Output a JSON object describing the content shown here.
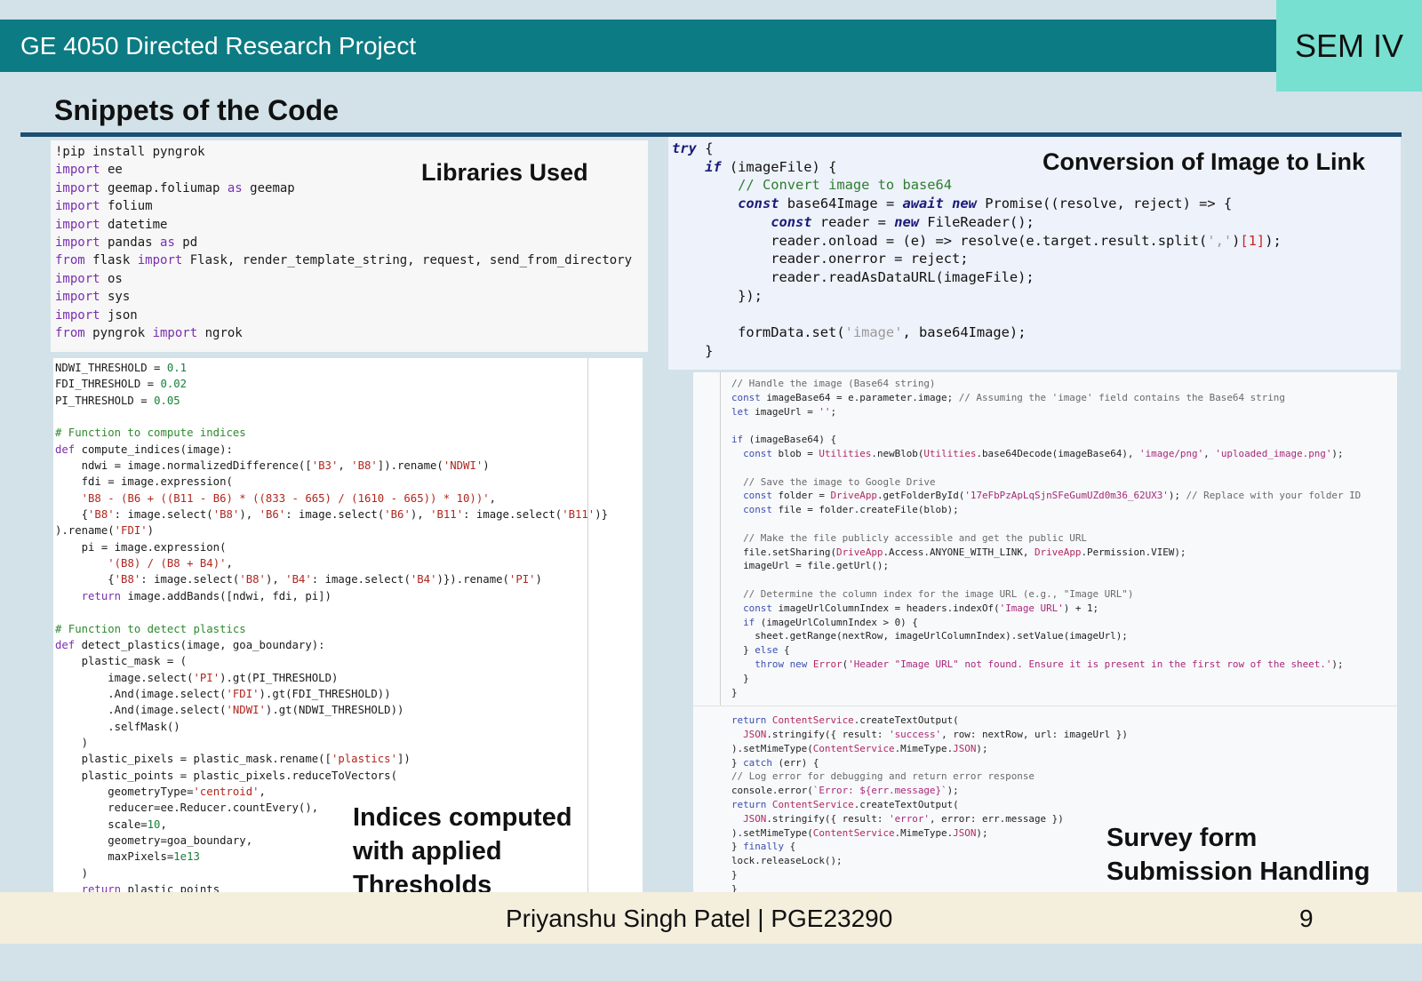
{
  "header": {
    "course_title": "GE 4050 Directed Research Project",
    "semester": "SEM IV"
  },
  "slide": {
    "title": "Snippets of the Code",
    "labels": {
      "libraries": "Libraries Used",
      "conversion": "Conversion of Image to Link",
      "indices_line1": "Indices computed",
      "indices_line2": "with applied",
      "indices_line3": "Thresholds",
      "survey_line1": "Survey form",
      "survey_line2": "Submission Handling"
    }
  },
  "footer": {
    "author": "Priyanshu Singh Patel | PGE23290",
    "page_number": "9"
  },
  "code": {
    "libraries": [
      "!pip install pyngrok",
      "import ee",
      "import geemap.foliumap as geemap",
      "import folium",
      "import datetime",
      "import pandas as pd",
      "from flask import Flask, render_template_string, request, send_from_directory",
      "import os",
      "import sys",
      "import json",
      "from pyngrok import ngrok"
    ],
    "conversion": [
      "try {",
      "    if (imageFile) {",
      "        // Convert image to base64",
      "        const base64Image = await new Promise((resolve, reject) => {",
      "            const reader = new FileReader();",
      "            reader.onload = (e) => resolve(e.target.result.split(',')[1]);",
      "            reader.onerror = reject;",
      "            reader.readAsDataURL(imageFile);",
      "        });",
      "",
      "        formData.set('image', base64Image);",
      "    }"
    ],
    "indices": [
      "NDWI_THRESHOLD = 0.1",
      "FDI_THRESHOLD = 0.02",
      "PI_THRESHOLD = 0.05",
      "",
      "# Function to compute indices",
      "def compute_indices(image):",
      "    ndwi = image.normalizedDifference(['B3', 'B8']).rename('NDWI')",
      "    fdi = image.expression(",
      "    'B8 - (B6 + ((B11 - B6) * ((833 - 665) / (1610 - 665)) * 10))',",
      "    {'B8': image.select('B8'), 'B6': image.select('B6'), 'B11': image.select('B11')}",
      ").rename('FDI')",
      "    pi = image.expression(",
      "        '(B8) / (B8 + B4)',",
      "        {'B8': image.select('B8'), 'B4': image.select('B4')}).rename('PI')",
      "    return image.addBands([ndwi, fdi, pi])",
      "",
      "# Function to detect plastics",
      "def detect_plastics(image, goa_boundary):",
      "    plastic_mask = (",
      "        image.select('PI').gt(PI_THRESHOLD)",
      "        .And(image.select('FDI').gt(FDI_THRESHOLD))",
      "        .And(image.select('NDWI').gt(NDWI_THRESHOLD))",
      "        .selfMask()",
      "    )",
      "    plastic_pixels = plastic_mask.rename(['plastics'])",
      "    plastic_points = plastic_pixels.reduceToVectors(",
      "        geometryType='centroid',",
      "        reducer=ee.Reducer.countEvery(),",
      "        scale=10,",
      "        geometry=goa_boundary,",
      "        maxPixels=1e13",
      "    )",
      "    return plastic_points"
    ],
    "survey": [
      "// Handle the image (Base64 string)",
      "const imageBase64 = e.parameter.image; // Assuming the 'image' field contains the Base64 string",
      "let imageUrl = '';",
      "",
      "if (imageBase64) {",
      "  const blob = Utilities.newBlob(Utilities.base64Decode(imageBase64), 'image/png', 'uploaded_image.png');",
      "",
      "  // Save the image to Google Drive",
      "  const folder = DriveApp.getFolderById('17eFbPzApLqSjnSFeGumUZd0m36_62UX3'); // Replace with your folder ID",
      "  const file = folder.createFile(blob);",
      "",
      "  // Make the file publicly accessible and get the public URL",
      "  file.setSharing(DriveApp.Access.ANYONE_WITH_LINK, DriveApp.Permission.VIEW);",
      "  imageUrl = file.getUrl();",
      "",
      "  // Determine the column index for the image URL (e.g., \"Image URL\")",
      "  const imageUrlColumnIndex = headers.indexOf('Image URL') + 1;",
      "  if (imageUrlColumnIndex > 0) {",
      "    sheet.getRange(nextRow, imageUrlColumnIndex).setValue(imageUrl);",
      "  } else {",
      "    throw new Error('Header \"Image URL\" not found. Ensure it is present in the first row of the sheet.');",
      "  }",
      "}",
      "",
      "return ContentService.createTextOutput(",
      "  JSON.stringify({ result: 'success', row: nextRow, url: imageUrl })",
      ").setMimeType(ContentService.MimeType.JSON);",
      "} catch (err) {",
      "// Log error for debugging and return error response",
      "console.error(`Error: ${err.message}`);",
      "return ContentService.createTextOutput(",
      "  JSON.stringify({ result: 'error', error: err.message })",
      ").setMimeType(ContentService.MimeType.JSON);",
      "} finally {",
      "lock.releaseLock();",
      "}",
      "}"
    ]
  },
  "colors": {
    "header_teal": "#0c7b83",
    "sem_box": "#78e0d0",
    "background": "#d2e2e8",
    "footer": "#f4eedc",
    "title_rule": "#1c4f72"
  }
}
